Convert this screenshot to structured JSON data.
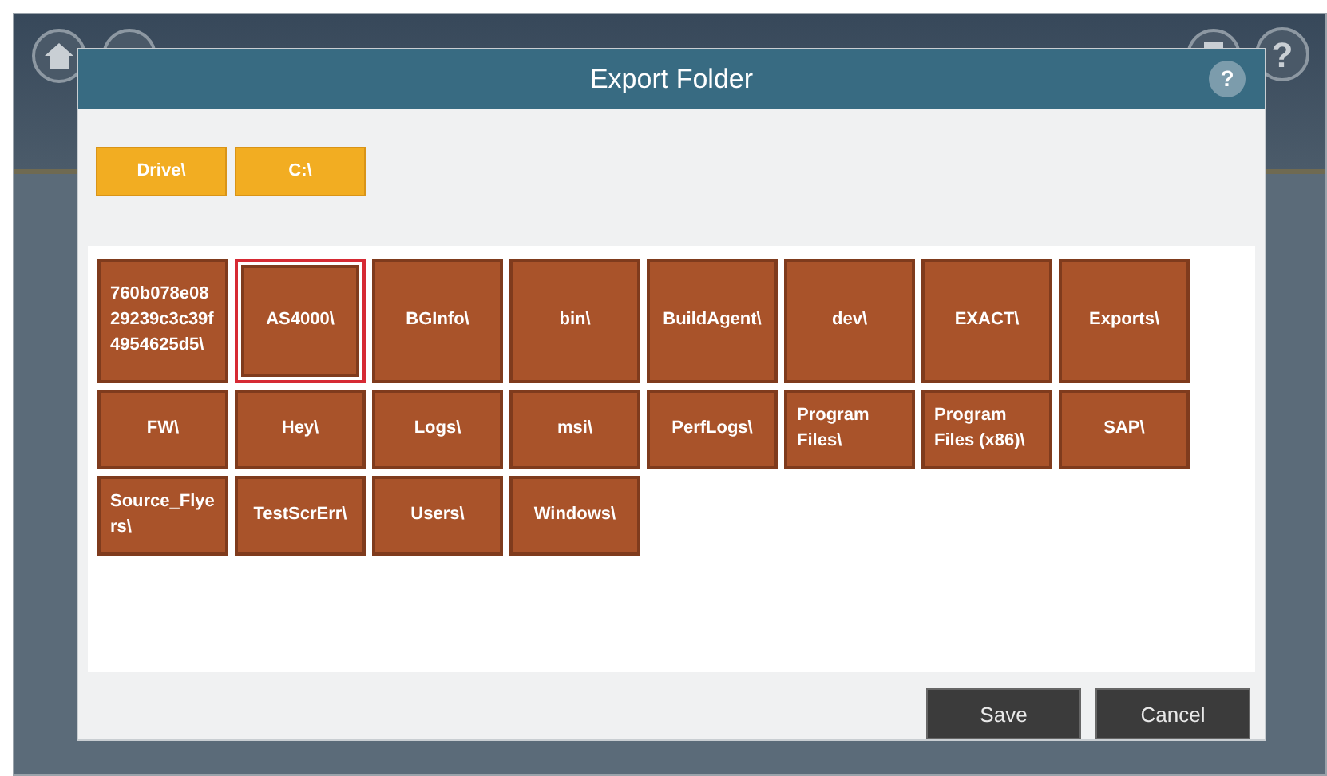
{
  "app_header": {
    "help_button": "?"
  },
  "dialog": {
    "title": "Export Folder",
    "help_button": "?",
    "breadcrumbs": [
      "Drive\\",
      "C:\\"
    ],
    "folders": [
      {
        "name": "760b078e0829239c3c39f4954625d5\\",
        "selected": false
      },
      {
        "name": "AS4000\\",
        "selected": true
      },
      {
        "name": "BGInfo\\",
        "selected": false
      },
      {
        "name": "bin\\",
        "selected": false
      },
      {
        "name": "BuildAgent\\",
        "selected": false
      },
      {
        "name": "dev\\",
        "selected": false
      },
      {
        "name": "EXACT\\",
        "selected": false
      },
      {
        "name": "Exports\\",
        "selected": false
      },
      {
        "name": "FW\\",
        "selected": false
      },
      {
        "name": "Hey\\",
        "selected": false
      },
      {
        "name": "Logs\\",
        "selected": false
      },
      {
        "name": "msi\\",
        "selected": false
      },
      {
        "name": "PerfLogs\\",
        "selected": false
      },
      {
        "name": "Program Files\\",
        "selected": false
      },
      {
        "name": "Program Files (x86)\\",
        "selected": false
      },
      {
        "name": "SAP\\",
        "selected": false
      },
      {
        "name": "Source_Flyers\\",
        "selected": false
      },
      {
        "name": "TestScrErr\\",
        "selected": false
      },
      {
        "name": "Users\\",
        "selected": false
      },
      {
        "name": "Windows\\",
        "selected": false
      }
    ],
    "buttons": [
      "Save",
      "Cancel"
    ]
  }
}
